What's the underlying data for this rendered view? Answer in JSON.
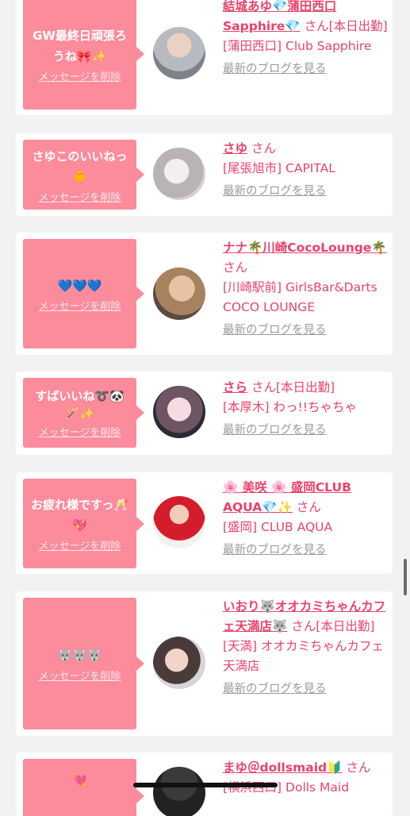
{
  "remove_label": "メッセージを削除",
  "blog_label": "最新のブログを見る",
  "san": "さん",
  "cards": [
    {
      "message": "GW最終日頑張ろうね🎀✨",
      "name": "結城あゆ💎蒲田西口Sapphire💎",
      "suffix": "[本日出勤]",
      "shop": "[蒲田西口] Club Sapphire"
    },
    {
      "message": "さゆこのいいねっ🐥",
      "name": "さゆ",
      "suffix": "",
      "shop": "[尾張旭市] CAPITAL"
    },
    {
      "message": "💙💙💙",
      "name": "ナナ🌴川崎CocoLounge🌴",
      "suffix": "",
      "shop": "[川崎駅前] GirlsBar&Darts COCO LOUNGE"
    },
    {
      "message": "すばいいね➰🐼🪄✨",
      "name": "さら",
      "suffix": "[本日出勤]",
      "shop": "[本厚木] わっ!!ちゃちゃ"
    },
    {
      "message": "お疲れ様ですっ🥂💖",
      "name": "🌸 美咲 🌸 盛岡CLUB AQUA💎✨",
      "suffix": "",
      "shop": "[盛岡] CLUB AQUA"
    },
    {
      "message": "🐺🐺🐺",
      "name": "いおり🐺オオカミちゃんカフェ天満店🐺",
      "suffix": "[本日出勤]",
      "shop": "[天満] オオカミちゃんカフェ天満店"
    },
    {
      "message": "💘",
      "name": "まゆ＠dollsmaid🔰",
      "suffix": "",
      "shop": "[横浜西口] Dolls Maid"
    }
  ]
}
